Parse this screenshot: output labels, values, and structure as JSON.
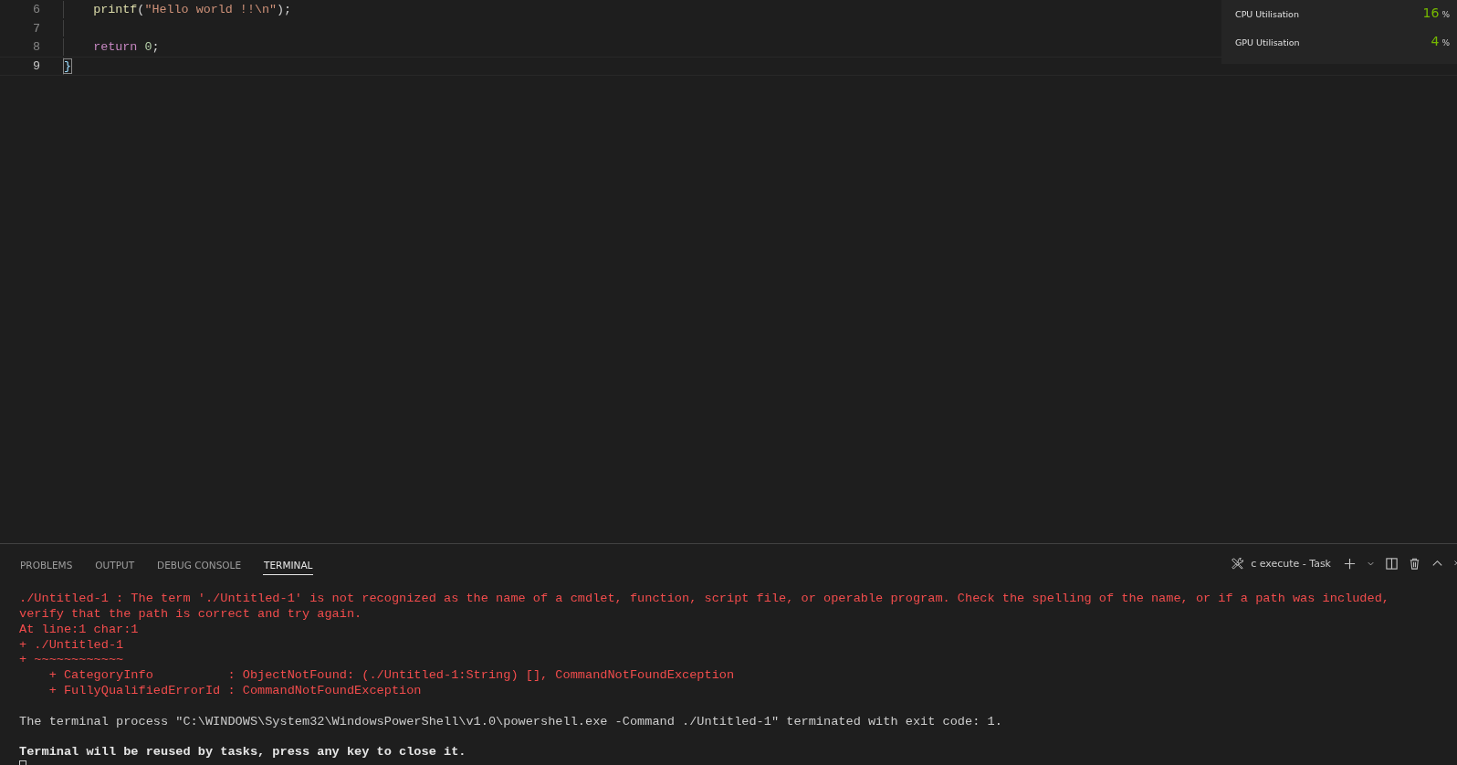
{
  "editor": {
    "lines": [
      {
        "number": "6",
        "current": false,
        "tokens": [
          {
            "kind": "func",
            "text": "    printf"
          },
          {
            "kind": "plain",
            "text": "("
          },
          {
            "kind": "string",
            "text": "\"Hello world !!\\n\""
          },
          {
            "kind": "plain",
            "text": ");"
          }
        ]
      },
      {
        "number": "7",
        "current": false
      },
      {
        "number": "8",
        "current": false,
        "tokens": [
          {
            "kind": "keyword",
            "text": "    return "
          },
          {
            "kind": "number",
            "text": "0"
          },
          {
            "kind": "plain",
            "text": ";"
          }
        ]
      },
      {
        "number": "9",
        "current": true,
        "tokens": [
          {
            "kind": "bracket",
            "text": "}"
          }
        ]
      }
    ]
  },
  "overlay": {
    "metrics": [
      {
        "label": "CPU Utilisation",
        "value": "16",
        "unit": "%"
      },
      {
        "label": "GPU Utilisation",
        "value": "4",
        "unit": "%"
      }
    ]
  },
  "panel": {
    "tabs": [
      {
        "label": "PROBLEMS",
        "selected": false
      },
      {
        "label": "OUTPUT",
        "selected": false
      },
      {
        "label": "DEBUG CONSOLE",
        "selected": false
      },
      {
        "label": "TERMINAL",
        "selected": true
      }
    ],
    "task": "c execute - Task",
    "terminal": [
      {
        "kind": "error",
        "text": "./Untitled-1 : The term './Untitled-1' is not recognized as the name of a cmdlet, function, script file, or operable program. Check the spelling of the name, or if a path was included, verify that the path is correct and try again."
      },
      {
        "kind": "error",
        "text": "At line:1 char:1"
      },
      {
        "kind": "error",
        "text": "+ ./Untitled-1"
      },
      {
        "kind": "error",
        "text": "+ ~~~~~~~~~~~~"
      },
      {
        "kind": "error",
        "text": "    + CategoryInfo          : ObjectNotFound: (./Untitled-1:String) [], CommandNotFoundException"
      },
      {
        "kind": "error",
        "text": "    + FullyQualifiedErrorId : CommandNotFoundException"
      },
      {
        "kind": "blank"
      },
      {
        "kind": "normal",
        "text": "The terminal process \"C:\\WINDOWS\\System32\\WindowsPowerShell\\v1.0\\powershell.exe -Command ./Untitled-1\" terminated with exit code: 1."
      },
      {
        "kind": "blank"
      },
      {
        "kind": "bold",
        "text": "Terminal will be reused by tasks, press any key to close it."
      }
    ]
  }
}
